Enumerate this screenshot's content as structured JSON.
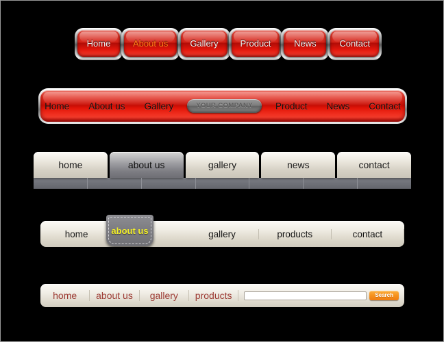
{
  "page": {
    "background_color": "#000000",
    "border_color": "#9a9a9a"
  },
  "bar1": {
    "style_name": "chrome-framed-red-buttons",
    "items": [
      {
        "label": "Home",
        "active": false
      },
      {
        "label": "About us",
        "active": true
      },
      {
        "label": "Gallery",
        "active": false
      },
      {
        "label": "Product",
        "active": false
      },
      {
        "label": "News",
        "active": false
      },
      {
        "label": "Contact",
        "active": false
      }
    ],
    "colors": {
      "button": "#d6251a",
      "text": "#f2f2f2",
      "active_text": "#ff7a18"
    }
  },
  "bar2": {
    "style_name": "glossy-red-pill-bar",
    "items": [
      {
        "label": "Home"
      },
      {
        "label": "About us"
      },
      {
        "label": "Gallery"
      }
    ],
    "company_badge": "YOUR COMPANY",
    "items_right": [
      {
        "label": "Product"
      },
      {
        "label": "News"
      },
      {
        "label": "Contact"
      }
    ],
    "colors": {
      "bar": "#e23124",
      "text": "#111111",
      "badge": "#7d7d7d",
      "badge_text": "#5b5b5b"
    }
  },
  "bar3": {
    "style_name": "cream-tabs-with-gray-strip",
    "tabs": [
      {
        "label": "home",
        "active": false
      },
      {
        "label": "about us",
        "active": true
      },
      {
        "label": "gallery",
        "active": false
      },
      {
        "label": "news",
        "active": false
      },
      {
        "label": "contact",
        "active": false
      }
    ],
    "strip_segments": 7,
    "colors": {
      "tab": "#e9e5db",
      "active_tab": "#7d7d83",
      "strip": "#6e7077",
      "text": "#1a1a1a"
    }
  },
  "bar4": {
    "style_name": "cream-bar-with-yellow-active-drop-tab",
    "items": [
      {
        "label": "home",
        "active": false
      },
      {
        "label": "about us",
        "active": true
      },
      {
        "label": "gallery",
        "active": false
      },
      {
        "label": "products",
        "active": false
      },
      {
        "label": "contact",
        "active": false
      }
    ],
    "colors": {
      "bar": "#efece3",
      "text": "#161616",
      "active_tab": "#7d7d82",
      "active_text": "#f2ee2a"
    }
  },
  "bar5": {
    "style_name": "cream-bar-with-search",
    "items": [
      {
        "label": "home"
      },
      {
        "label": "about us"
      },
      {
        "label": "gallery"
      },
      {
        "label": "products"
      }
    ],
    "search": {
      "value": "",
      "placeholder": "",
      "button_label": "Search"
    },
    "colors": {
      "bar": "#f1eee6",
      "text": "#9c3a33",
      "search_button": "#f6921e"
    }
  }
}
